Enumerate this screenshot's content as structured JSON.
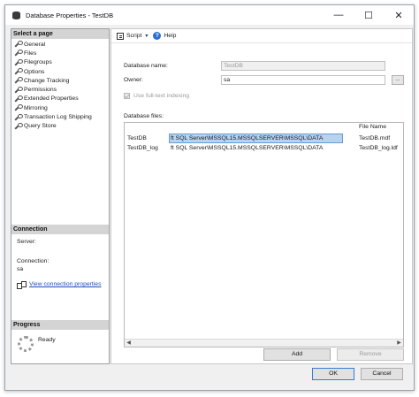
{
  "window": {
    "title": "Database Properties - TestDB",
    "controls": {
      "minimize": "—",
      "maximize": "☐",
      "close": "✕"
    }
  },
  "sidebar": {
    "select_page_header": "Select a page",
    "pages": [
      {
        "label": "General"
      },
      {
        "label": "Files"
      },
      {
        "label": "Filegroups"
      },
      {
        "label": "Options"
      },
      {
        "label": "Change Tracking"
      },
      {
        "label": "Permissions"
      },
      {
        "label": "Extended Properties"
      },
      {
        "label": "Mirroring"
      },
      {
        "label": "Transaction Log Shipping"
      },
      {
        "label": "Query Store"
      }
    ],
    "connection": {
      "header": "Connection",
      "server_label": "Server:",
      "server_value": "",
      "connection_label": "Connection:",
      "connection_value": "sa",
      "view_link": "View connection properties"
    },
    "progress": {
      "header": "Progress",
      "status": "Ready"
    }
  },
  "toolbar": {
    "script_label": "Script",
    "caret": "▾",
    "help_label": "Help",
    "help_glyph": "?"
  },
  "form": {
    "database_name_label": "Database name:",
    "database_name_value": "TestDB",
    "owner_label": "Owner:",
    "owner_value": "sa",
    "owner_browse": "...",
    "fulltext_label": "Use full-text indexing",
    "fulltext_checked": true,
    "database_files_label": "Database files:"
  },
  "files_grid": {
    "file_name_header": "File Name",
    "rows": [
      {
        "logical": "TestDB",
        "path": "ft SQL Server\\MSSQL15.MSSQLSERVER\\MSSQL\\DATA",
        "file_name": "TestDB.mdf"
      },
      {
        "logical": "TestDB_log",
        "path": "ft SQL Server\\MSSQL15.MSSQLSERVER\\MSSQL\\DATA",
        "file_name": "TestDB_log.ldf"
      }
    ],
    "scroll_left": "◀",
    "scroll_right": "▶"
  },
  "buttons": {
    "add": "Add",
    "remove": "Remove",
    "ok": "OK",
    "cancel": "Cancel"
  }
}
